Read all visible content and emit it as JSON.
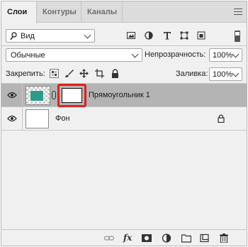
{
  "tabs": [
    {
      "label": "Слои",
      "active": true
    },
    {
      "label": "Контуры",
      "active": false
    },
    {
      "label": "Каналы",
      "active": false
    }
  ],
  "filter": {
    "kind_label": "Вид",
    "icons": [
      "image-filter-icon",
      "adjustment-filter-icon",
      "type-filter-icon",
      "shape-filter-icon",
      "smart-object-filter-icon",
      "filter-toggle"
    ]
  },
  "blend": {
    "mode": "Обычные",
    "opacity_label": "Непрозрачность:",
    "opacity_value": "100%"
  },
  "lock": {
    "label": "Закрепить:",
    "fill_label": "Заливка:",
    "fill_value": "100%"
  },
  "layers": [
    {
      "name": "Прямоугольник 1",
      "selected": true,
      "visible": true,
      "has_mask": true,
      "thumb_color": "#2a9a8a"
    },
    {
      "name": "Фон",
      "selected": false,
      "visible": true,
      "locked": true
    }
  ],
  "bottom_icons": [
    "link-layers-icon",
    "fx-icon",
    "add-mask-icon",
    "adjustment-layer-icon",
    "new-group-icon",
    "new-layer-icon",
    "delete-layer-icon"
  ],
  "colors": {
    "highlight": "#e0201b",
    "selected_row": "#b4b4b4",
    "teal": "#2a9a8a"
  }
}
